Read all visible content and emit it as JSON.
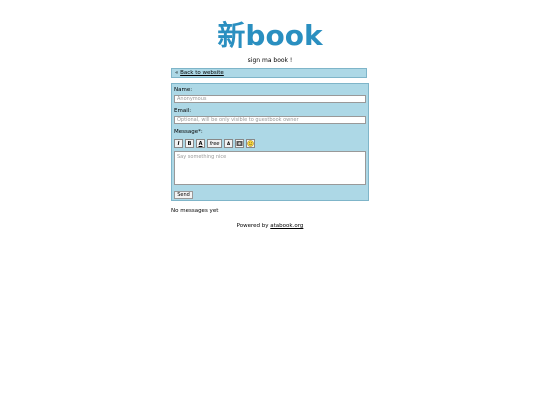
{
  "header": {
    "logo_text": "新book",
    "tagline": "sign ma book !"
  },
  "nav": {
    "back_prefix": "«",
    "back_link": "Back to website"
  },
  "form": {
    "name_label": "Name:",
    "name_placeholder": "Anonymous",
    "email_label": "Email:",
    "email_placeholder": "Optional, will be only visible to guestbook owner",
    "message_label": "Message*:",
    "message_placeholder": "Say something nice",
    "toolbar": {
      "italic": "I",
      "bold": "B",
      "underline": "A",
      "free": "free",
      "font": "A",
      "image": "",
      "smiley": ""
    },
    "send_label": "Send"
  },
  "messages": {
    "empty_text": "No messages yet"
  },
  "footer": {
    "powered_text": "Powered by",
    "powered_link": "atabook.org"
  },
  "colors": {
    "accent": "#2a8fc0",
    "panel": "#add8e6"
  }
}
